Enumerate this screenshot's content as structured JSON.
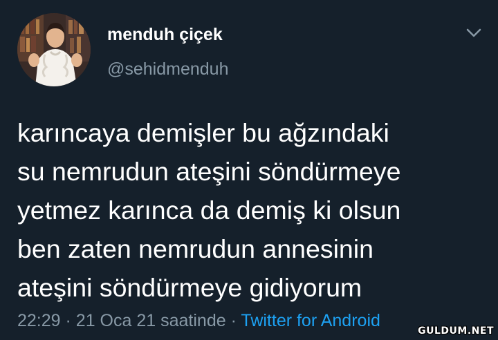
{
  "user": {
    "name": "menduh çiçek",
    "handle": "@sehidmenduh"
  },
  "tweet": {
    "lines": [
      "karıncaya demişler bu ağzındaki",
      "su nemrudun ateşini söndürmeye",
      "yetmez karınca da demiş ki olsun",
      "ben zaten nemrudun annesinin",
      "ateşini söndürmeye gidiyorum"
    ],
    "time": "22:29",
    "date": "21 Oca 21",
    "suffix": "saatinde",
    "separator": "·",
    "source": "Twitter for Android"
  },
  "watermark": "GULDUM.NET",
  "icons": {
    "more": "chevron-down-icon",
    "avatar": "avatar"
  },
  "colors": {
    "background": "#15202b",
    "primary_text": "#ffffff",
    "secondary_text": "#8899a6",
    "link": "#1da1f2"
  }
}
